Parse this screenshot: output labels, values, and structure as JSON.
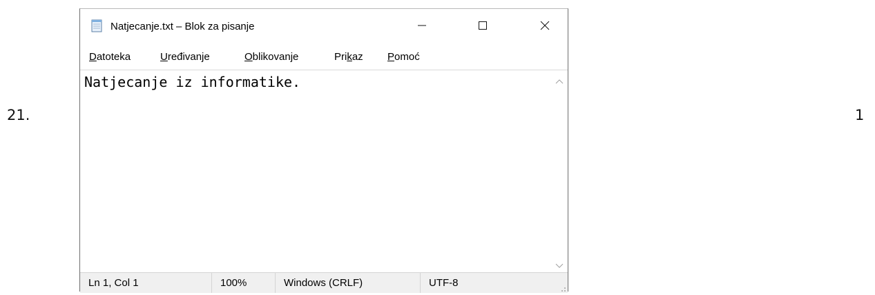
{
  "outside": {
    "left_number": "21.",
    "right_number": "1"
  },
  "window": {
    "title": "Natjecanje.txt – Blok za pisanje",
    "app_icon": "notepad-icon",
    "controls": {
      "minimize": "minimize-icon",
      "maximize": "maximize-icon",
      "close": "close-icon"
    }
  },
  "menu": {
    "items": [
      {
        "accel": "D",
        "rest": "atoteka"
      },
      {
        "accel": "U",
        "rest": "ređivanje"
      },
      {
        "accel": "O",
        "rest": "blikovanje"
      },
      {
        "pre": "Pri",
        "accel": "k",
        "rest": "az"
      },
      {
        "accel": "P",
        "rest": "omoć"
      }
    ]
  },
  "editor": {
    "content": "Natjecanje iz informatike."
  },
  "status": {
    "position": "Ln 1, Col 1",
    "zoom": "100%",
    "line_endings": "Windows (CRLF)",
    "encoding": "UTF-8"
  },
  "colors": {
    "statusbar_bg": "#f0f0f0",
    "window_border": "#6e6e6e"
  }
}
